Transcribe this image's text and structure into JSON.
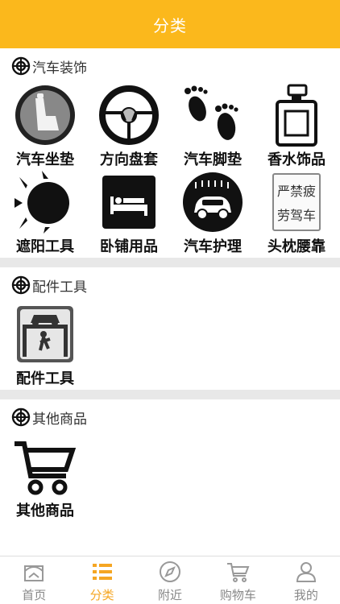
{
  "header": {
    "title": "分类"
  },
  "sections": [
    {
      "title": "汽车装饰",
      "items": [
        {
          "label": "汽车坐垫",
          "icon": "car-seat-icon"
        },
        {
          "label": "方向盘套",
          "icon": "steering-wheel-icon"
        },
        {
          "label": "汽车脚垫",
          "icon": "footprint-icon"
        },
        {
          "label": "香水饰品",
          "icon": "perfume-icon"
        },
        {
          "label": "遮阳工具",
          "icon": "sun-icon"
        },
        {
          "label": "卧铺用品",
          "icon": "bed-icon"
        },
        {
          "label": "汽车护理",
          "icon": "car-wash-icon"
        },
        {
          "label": "头枕腰靠",
          "icon": "pillow-sign-icon",
          "sign_text": [
            "严禁疲",
            "劳驾车"
          ]
        }
      ]
    },
    {
      "title": "配件工具",
      "items": [
        {
          "label": "配件工具",
          "icon": "car-lift-icon"
        }
      ]
    },
    {
      "title": "其他商品",
      "items": [
        {
          "label": "其他商品",
          "icon": "shopping-cart-icon"
        }
      ]
    }
  ],
  "tabbar": {
    "items": [
      {
        "label": "首页",
        "icon": "home-icon",
        "active": false
      },
      {
        "label": "分类",
        "icon": "category-list-icon",
        "active": true
      },
      {
        "label": "附近",
        "icon": "compass-icon",
        "active": false
      },
      {
        "label": "购物车",
        "icon": "cart-icon",
        "active": false
      },
      {
        "label": "我的",
        "icon": "user-icon",
        "active": false
      }
    ]
  },
  "colors": {
    "accent": "#fbb81c",
    "active_tab": "#f5a623"
  }
}
